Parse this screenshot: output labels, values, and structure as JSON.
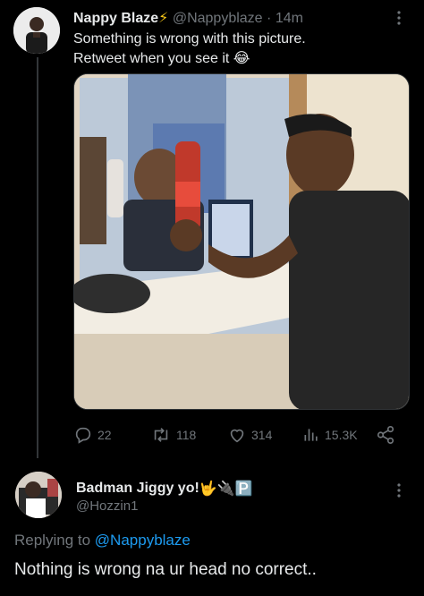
{
  "tweet": {
    "author_name": "Nappy Blaze",
    "author_badge": "⚡",
    "handle": "@Nappyblaze",
    "separator": "·",
    "time": "14m",
    "text_line1": "Something is wrong with this picture.",
    "text_line2": "Retweet when you see it",
    "text_emoji": "😂",
    "media_icon": "photo-two-men-mirror-drinks",
    "actions": {
      "replies": "22",
      "retweets": "118",
      "likes": "314",
      "views": "15.3K"
    }
  },
  "reply": {
    "author_name": "Badman Jiggy yo!",
    "author_emojis": "🤟🔌🅿️",
    "handle": "@Hozzin1",
    "replying_prefix": "Replying to",
    "replying_mention": "@Nappyblaze",
    "text": "Nothing is wrong na ur head no correct.."
  },
  "colors": {
    "background": "#000000",
    "text_primary": "#e7e9ea",
    "text_secondary": "#71767b",
    "link": "#1d9bf0",
    "divider": "#333639"
  }
}
